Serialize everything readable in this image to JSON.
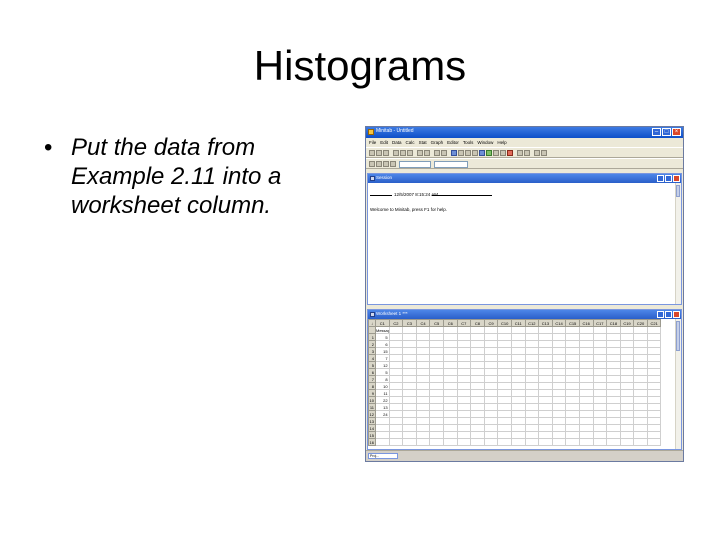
{
  "slide": {
    "title": "Histograms",
    "bullet": "Put the data from Example 2.11 into a worksheet column."
  },
  "app": {
    "window_title": "Minitab - Untitled",
    "menu": [
      "File",
      "Edit",
      "Data",
      "Calc",
      "Stat",
      "Graph",
      "Editor",
      "Tools",
      "Window",
      "Help"
    ],
    "session": {
      "title": "Session",
      "header": "12/5/2007 8:15:24 AM",
      "welcome": "Welcome to Minitab, press F1 for help."
    },
    "worksheet": {
      "title": "Worksheet 1 ***",
      "columns": [
        "C1",
        "C2",
        "C3",
        "C4",
        "C5",
        "C6",
        "C7",
        "C8",
        "C9",
        "C10",
        "C11",
        "C12",
        "C13",
        "C14",
        "C15",
        "C16",
        "C17",
        "C18",
        "C19",
        "C20",
        "C21"
      ],
      "column_names": [
        "Messages"
      ],
      "rows": [
        "1",
        "2",
        "3",
        "4",
        "5",
        "6",
        "7",
        "8",
        "9",
        "10",
        "11",
        "12",
        "13",
        "14",
        "15",
        "16"
      ],
      "values": [
        "5",
        "6",
        "15",
        "7",
        "12",
        "5",
        "8",
        "10",
        "11",
        "22",
        "13",
        "24"
      ]
    },
    "taskbar": [
      "Proj..."
    ]
  }
}
